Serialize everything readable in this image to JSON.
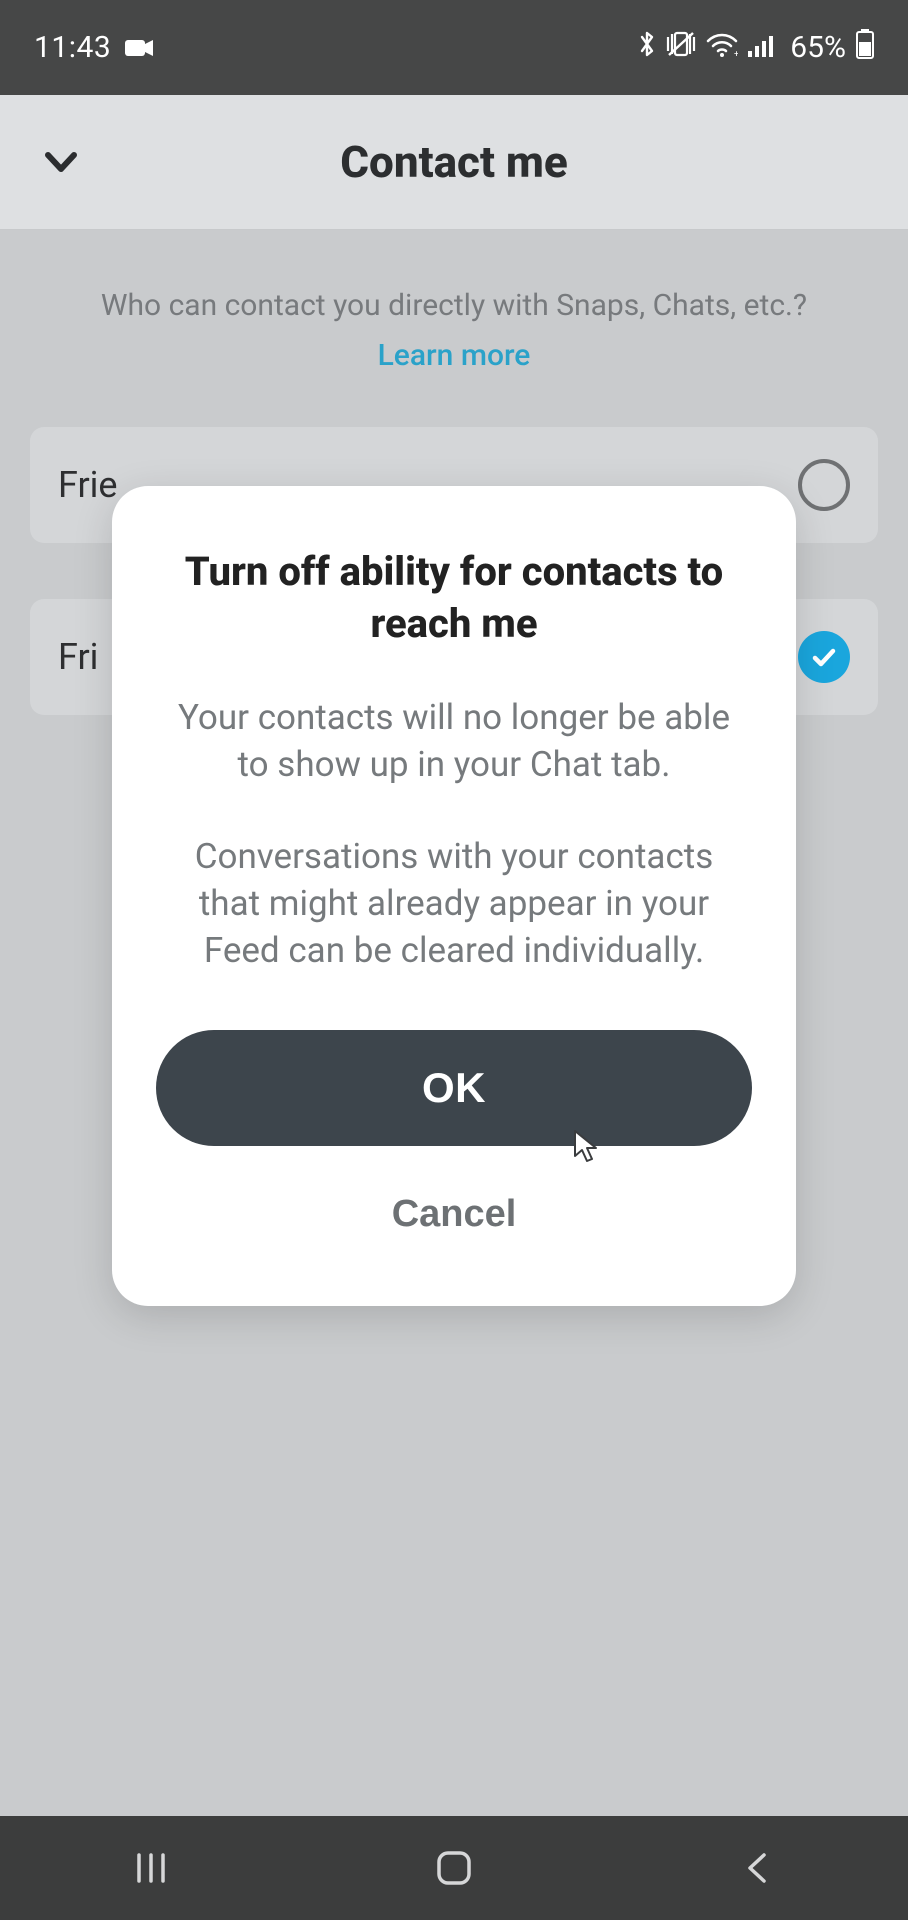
{
  "status": {
    "time": "11:43",
    "battery": "65%"
  },
  "header": {
    "title": "Contact me"
  },
  "page": {
    "subtitle": "Who can contact you directly with Snaps, Chats, etc.?",
    "learn_more": "Learn more",
    "options": [
      {
        "label": "Frie",
        "selected": false
      },
      {
        "label": "Fri",
        "selected": true
      }
    ]
  },
  "modal": {
    "title": "Turn off ability for contacts to reach me",
    "body1": "Your contacts will no longer be able to show up in your Chat tab.",
    "body2": "Conversations with your contacts that might already appear in your Feed can be cleared individually.",
    "ok": "OK",
    "cancel": "Cancel"
  }
}
